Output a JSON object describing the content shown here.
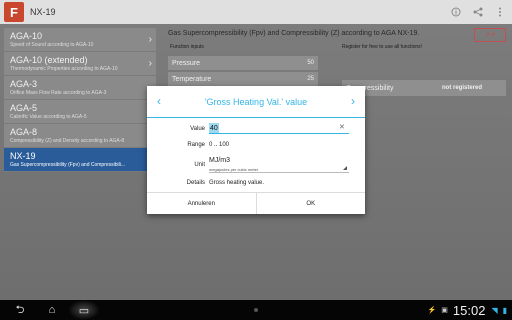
{
  "app": {
    "logo_letter": "F",
    "title": "NX-19"
  },
  "actionbar_icons": [
    "info-icon",
    "share-icon",
    "overflow-menu-icon"
  ],
  "list": [
    {
      "title": "AGA-10",
      "subtitle": "Speed of Sound according to AGA-10",
      "chevron": "›"
    },
    {
      "title": "AGA-10 (extended)",
      "subtitle": "Thermodynamic Properties according to AGA-10",
      "chevron": "›"
    },
    {
      "title": "AGA-3",
      "subtitle": "Orifice Mass Flow Rate according to AGA-3",
      "chevron": ""
    },
    {
      "title": "AGA-5",
      "subtitle": "Calorific Value according to AGA-5",
      "chevron": ""
    },
    {
      "title": "AGA-8",
      "subtitle": "Compressibility (Z) and Density according to AGA-8",
      "chevron": ""
    },
    {
      "title": "NX-19",
      "subtitle": "Gas Supercompressibility (Fpv) and Compressibili...",
      "chevron": ""
    }
  ],
  "panel": {
    "title": "Gas Supercompressibility (Fpv) and Compressibility (Z) according to AGA NX-19.",
    "input_section": "Function inputs",
    "register_section": "Register for free to use all functions!",
    "pressure_label": "Pressure",
    "pressure_value": "50",
    "temperature_label": "Temperature",
    "temperature_value": "25",
    "compressibility_label": "Compressibility",
    "compressibility_value": "not registered",
    "graph_label": "↗↗"
  },
  "dialog": {
    "title": "'Gross Heating Val.' value",
    "prev": "‹",
    "next": "›",
    "value_label": "Value",
    "value": "40",
    "clear": "✕",
    "range_label": "Range",
    "range_value": "0 .. 100",
    "unit_label": "Unit",
    "unit_value": "MJ/m3",
    "unit_description": "megajoules per cubic meter",
    "details_label": "Details",
    "details_value": "Gross heating value.",
    "cancel": "Annuleren",
    "ok": "OK"
  },
  "system": {
    "back": "⮌",
    "home": "⌂",
    "recent": "▭",
    "clock": "15:02"
  },
  "colors": {
    "accent": "#33b5e5",
    "selected_item": "#2a5c9a",
    "logo": "#c9472e"
  }
}
